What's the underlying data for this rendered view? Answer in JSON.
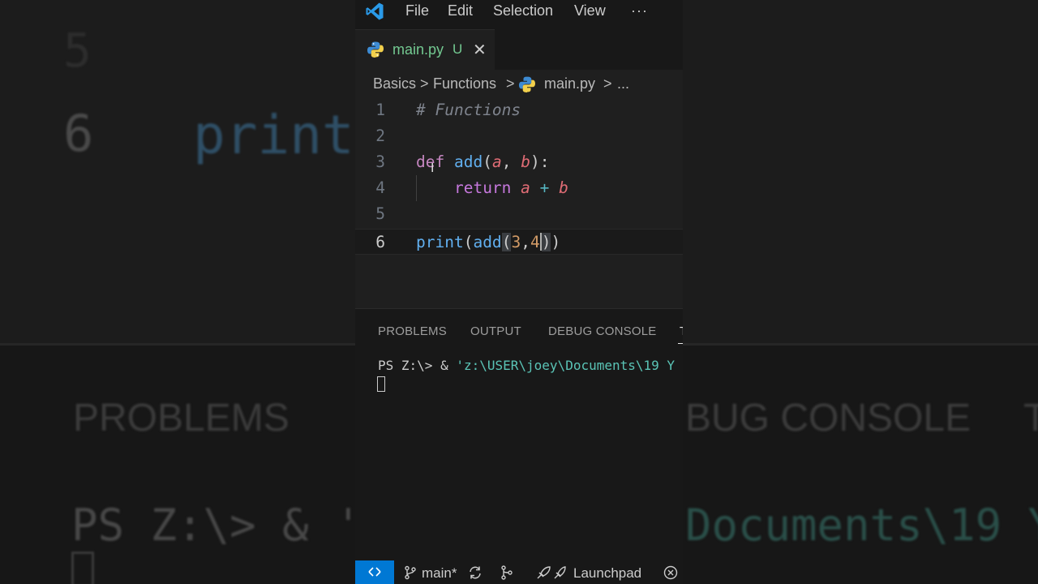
{
  "background": {
    "line5": "5",
    "line6": "6",
    "print_text": "print",
    "problems": "PROBLEMS",
    "debug_console": "BUG CONSOLE",
    "terminal_t": "T",
    "ps_prompt": "PS Z:\\> & '",
    "docs_path": "Documents\\19 Y"
  },
  "titlebar": {
    "menu": {
      "file": "File",
      "edit": "Edit",
      "selection": "Selection",
      "view": "View",
      "more": "···"
    }
  },
  "tab": {
    "label": "main.py",
    "status": "U",
    "close": "✕"
  },
  "breadcrumb": {
    "items": [
      "Basics",
      "Functions",
      "main.py",
      "..."
    ],
    "sep": ">"
  },
  "editor": {
    "line_numbers": [
      "1",
      "2",
      "3",
      "4",
      "5",
      "6"
    ],
    "active_line": "6",
    "code": {
      "l1_comment": "# Functions",
      "l3_kw": "def",
      "l3_fn": "add",
      "l3_open": "(",
      "l3_p1": "a",
      "l3_comma": ", ",
      "l3_p2": "b",
      "l3_close": "):",
      "l4_kw": "return",
      "l4_a": "a",
      "l4_op": " + ",
      "l4_b": "b",
      "l6_print": "print",
      "l6_p1": "(",
      "l6_add": "add",
      "l6_p2": "(",
      "l6_n1": "3",
      "l6_comma": ",",
      "l6_n2": "4",
      "l6_c1": ")",
      "l6_c2": ")"
    }
  },
  "panel": {
    "tabs": {
      "problems": "PROBLEMS",
      "output": "OUTPUT",
      "debug": "DEBUG CONSOLE",
      "terminal": "T"
    },
    "terminal_prompt": "PS Z:\\> & ",
    "terminal_path": "'z:\\USER\\joey\\Documents\\19 Y"
  },
  "statusbar": {
    "branch": "main*",
    "launchpad": "Launchpad"
  },
  "colors": {
    "accent": "#0078d4",
    "modified": "#73c991",
    "keyword": "#c586c0",
    "function": "#dcdcaa"
  }
}
